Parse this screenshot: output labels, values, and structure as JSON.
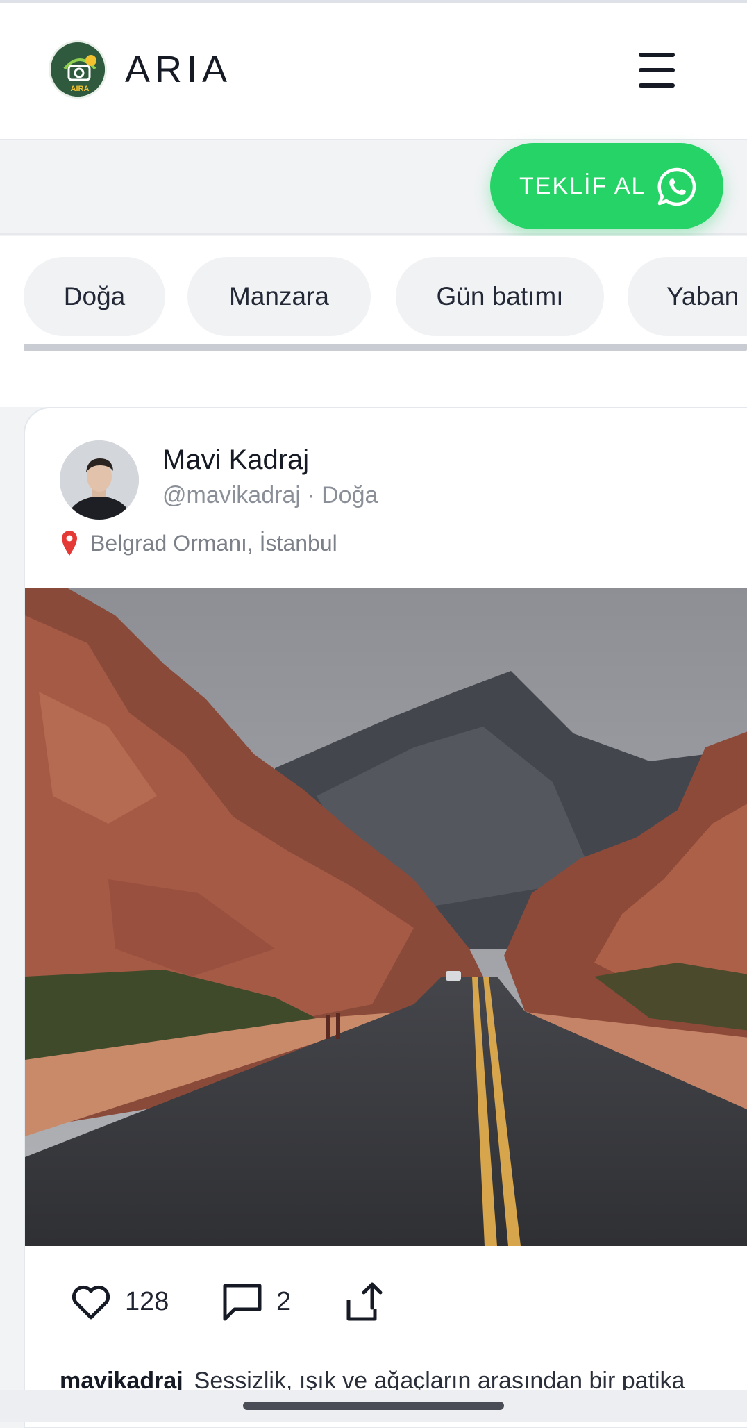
{
  "header": {
    "brand": "ARIA",
    "logo_text": "AIRA",
    "menu_icon": "hamburger-menu-icon"
  },
  "cta": {
    "label": "TEKLİF AL",
    "icon": "whatsapp-icon",
    "color": "#25d366"
  },
  "categories": [
    "Doğa",
    "Manzara",
    "Gün batımı",
    "Yaban"
  ],
  "post": {
    "author": "Mavi Kadraj",
    "handle": "@mavikadraj · Doğa",
    "location": "Belgrad Ormanı, İstanbul",
    "likes": "128",
    "comments": "2",
    "caption_user": "mavikadraj",
    "caption_text": "Sessizlik, ışık ve ağaçların arasından bir patika"
  },
  "colors": {
    "accent": "#25d366",
    "text": "#151a24",
    "muted": "#8a8f98"
  }
}
